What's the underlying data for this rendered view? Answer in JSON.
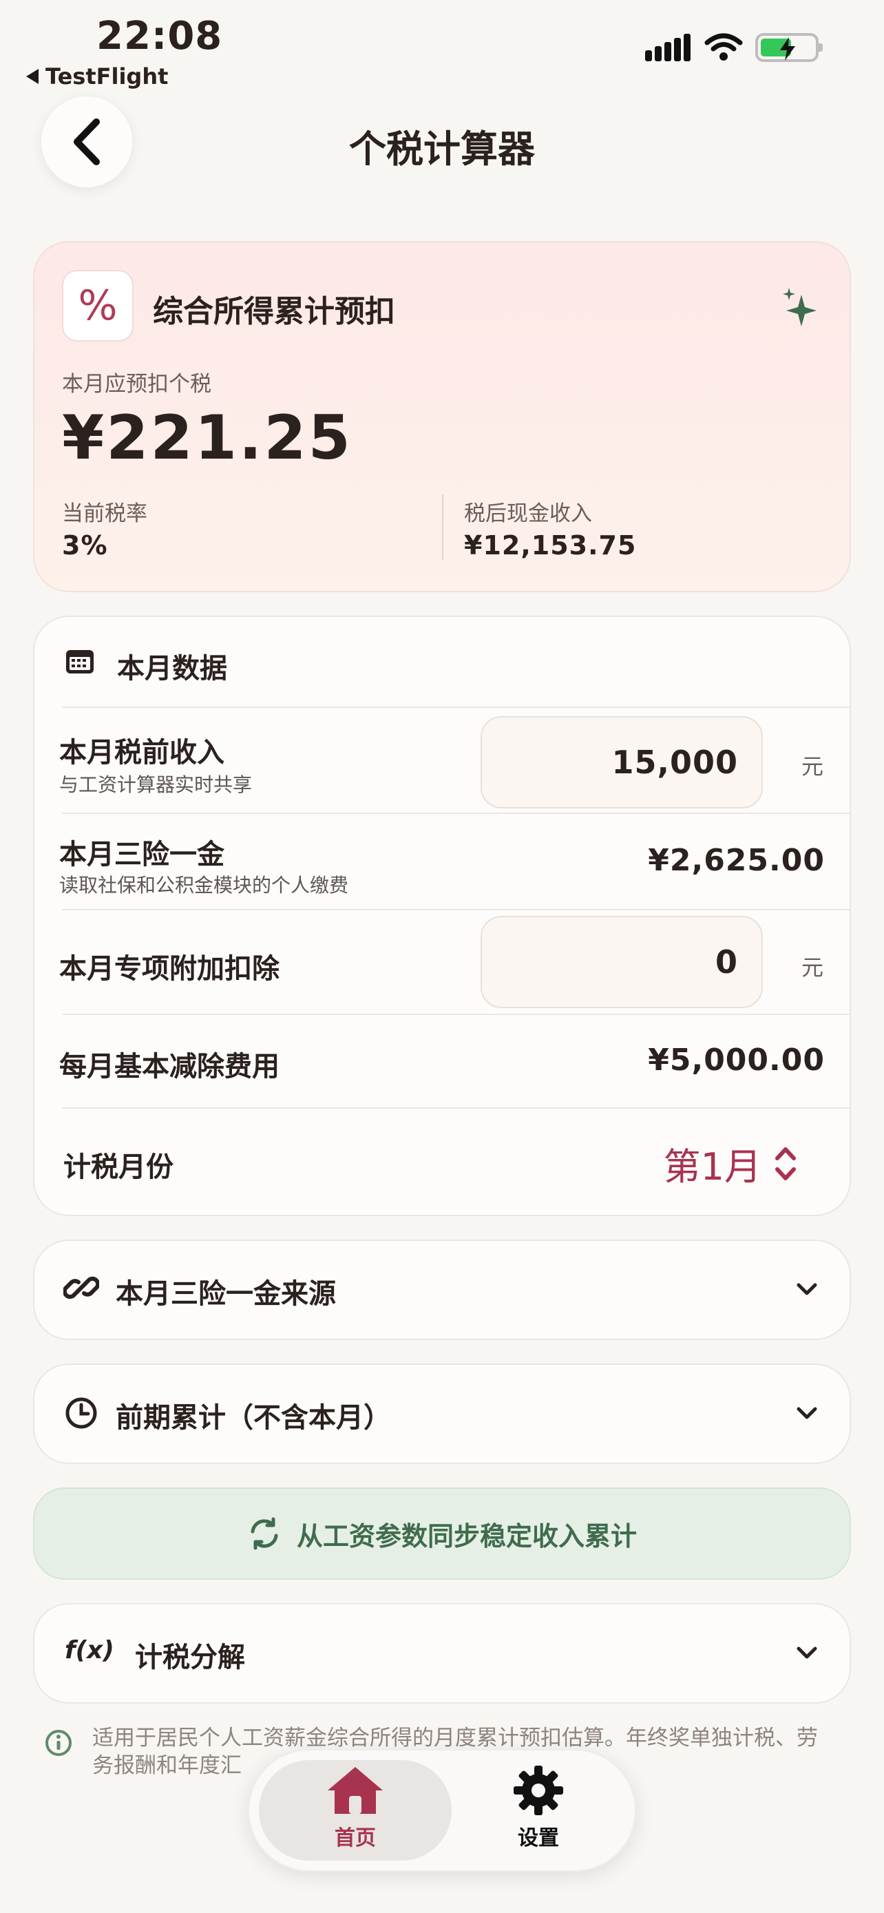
{
  "status_bar": {
    "time": "22:08",
    "back_app": "TestFlight"
  },
  "nav": {
    "title": "个税计算器"
  },
  "summary": {
    "title": "综合所得累计预扣",
    "badge": "%",
    "monthly_tax_label": "本月应预扣个税",
    "monthly_tax_value": "¥221.25",
    "rate_label": "当前税率",
    "rate_value": "3%",
    "after_tax_label": "税后现金收入",
    "after_tax_value": "¥12,153.75"
  },
  "monthly_data": {
    "section_title": "本月数据",
    "pretax_income": {
      "title": "本月税前收入",
      "subtitle": "与工资计算器实时共享",
      "value": "15,000",
      "unit": "元"
    },
    "insurance": {
      "title": "本月三险一金",
      "subtitle": "读取社保和公积金模块的个人缴费",
      "value": "¥2,625.00"
    },
    "special_deduction": {
      "title": "本月专项附加扣除",
      "value": "0",
      "unit": "元"
    },
    "basic_deduction": {
      "title": "每月基本减除费用",
      "value": "¥5,000.00"
    },
    "tax_month": {
      "title": "计税月份",
      "value": "第1月"
    }
  },
  "sections": {
    "insurance_source": "本月三险一金来源",
    "previous_cumulative": "前期累计（不含本月）",
    "sync_button": "从工资参数同步稳定收入累计",
    "fx_label": "f(x)",
    "tax_breakdown": "计税分解"
  },
  "footnote": "适用于居民个人工资薪金综合所得的月度累计预扣估算。年终奖单独计税、劳务报酬和年度汇",
  "tabbar": {
    "home": "首页",
    "settings": "设置"
  },
  "colors": {
    "accent": "#a8334f",
    "green": "#3f6c4d",
    "background": "#f8f6f3"
  }
}
